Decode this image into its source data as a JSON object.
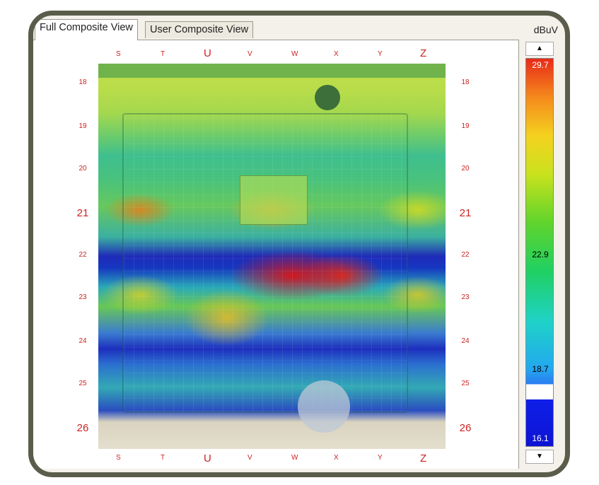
{
  "tabs": [
    {
      "label": "Full Composite View",
      "active": true
    },
    {
      "label": "User Composite View",
      "active": false
    }
  ],
  "unit_label": "dBuV",
  "axis": {
    "x_top": [
      "S",
      "T",
      "U",
      "V",
      "W",
      "X",
      "Y",
      "Z"
    ],
    "x_bottom": [
      "S",
      "T",
      "U",
      "V",
      "W",
      "X",
      "Y",
      "Z"
    ],
    "y_left": [
      "18",
      "19",
      "20",
      "21",
      "22",
      "23",
      "24",
      "25",
      "26"
    ],
    "y_right": [
      "18",
      "19",
      "20",
      "21",
      "22",
      "23",
      "24",
      "25",
      "26"
    ]
  },
  "scale": {
    "max": "29.7",
    "mid": "22.9",
    "threshold": "18.7",
    "min": "16.1",
    "up_arrow": "▲",
    "down_arrow": "▼",
    "colors": {
      "high": "#e82a1a",
      "mid": "#1fd063",
      "low": "#0d14d4"
    }
  }
}
